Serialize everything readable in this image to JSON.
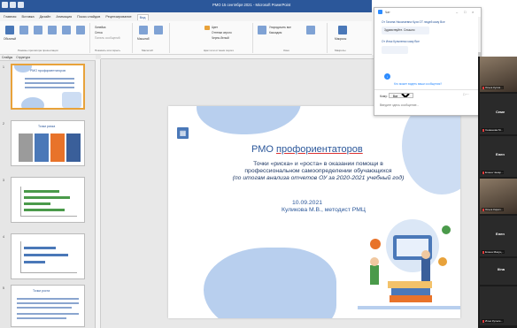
{
  "window": {
    "title": "РМО 15 сентября 2021 - Microsoft PowerPoint"
  },
  "ribbon": {
    "tabs": [
      "Главная",
      "Вставка",
      "Дизайн",
      "Анимация",
      "Показ слайдов",
      "Рецензирование",
      "Вид"
    ],
    "active_tab": "Вид",
    "group_labels": [
      "Режимы просмотра презентации",
      "Режимы образцов",
      "Показать или скрыть",
      "Масштаб",
      "Цвет или оттенки серого",
      "Окно",
      "Макросы"
    ],
    "buttons": {
      "normal": "Обычный",
      "sorter": "Сортировщик слайдов",
      "notes_page": "Страницы заметок",
      "reading": "Показ слайдов",
      "slide_master": "Образец слайдов",
      "handout_master": "Образец выдач",
      "notes_master": "Образец заметок",
      "ruler": "Линейка",
      "grid": "Сетка",
      "guides": "Панель сообщений",
      "zoom": "Масштаб",
      "fit": "Вписать в окно",
      "color": "Цвет",
      "grayscale": "Оттенки серого",
      "bw": "Черно-белый",
      "new_window": "Новое окно",
      "arrange": "Упорядочить все",
      "cascade": "Каскадом",
      "move_split": "Перейти в другое окно",
      "macros": "Макросы"
    }
  },
  "thumbs_panel": {
    "tab_slides": "Слайды",
    "tab_outline": "Структура",
    "slides": [
      {
        "number": "1",
        "title": "РМО профориентаторов"
      },
      {
        "number": "2",
        "title": "Точки риска"
      },
      {
        "number": "3",
        "title": ""
      },
      {
        "number": "4",
        "title": ""
      },
      {
        "number": "5",
        "title": "Точки роста"
      }
    ]
  },
  "slide": {
    "title_prefix": "РМО ",
    "title_underlined": "профориентаторов",
    "subtitle_line1": "Точки «риска» и «роста» в оказании помощи в",
    "subtitle_line2": "профессиональном самоопределении обучающихся",
    "subtitle_line3": "(по итогам анализа отчетов ОУ за 2020-2021 учебный год)",
    "date": "10.09.2021",
    "author": "Куликова М.В., методист РМЦ"
  },
  "chat": {
    "title": "Чат",
    "messages": [
      {
        "from": "От Галина Николаевна Кузя ОТ людей кому Все",
        "text": "Здравствуйте. Слышно"
      },
      {
        "from": "От Илья Кульпенок кому Все",
        "text": ""
      }
    ],
    "notice": "Кто может видеть ваши сообщения?",
    "to_label": "Кому:",
    "to_value": "Все",
    "input_placeholder": "Введите здесь сообщение..."
  },
  "videos": {
    "tiles": [
      {
        "name": "",
        "label": "Ольга Кулик..."
      },
      {
        "name": "Семе",
        "label": "Семенова М..."
      },
      {
        "name": "Елен",
        "label": "Елена Чекар..."
      },
      {
        "name": "",
        "label": "Ольга Кирил..."
      },
      {
        "name": "Елен",
        "label": "Елена Мазуц..."
      },
      {
        "name": "Ilina",
        "label": ""
      },
      {
        "name": "",
        "label": "Илья Кульпе..."
      }
    ]
  },
  "colors": {
    "accent": "#2b579a",
    "slide_blob": "#b8cfee",
    "chat_brand": "#2d8cff",
    "thumb_selected": "#e8a23a"
  }
}
